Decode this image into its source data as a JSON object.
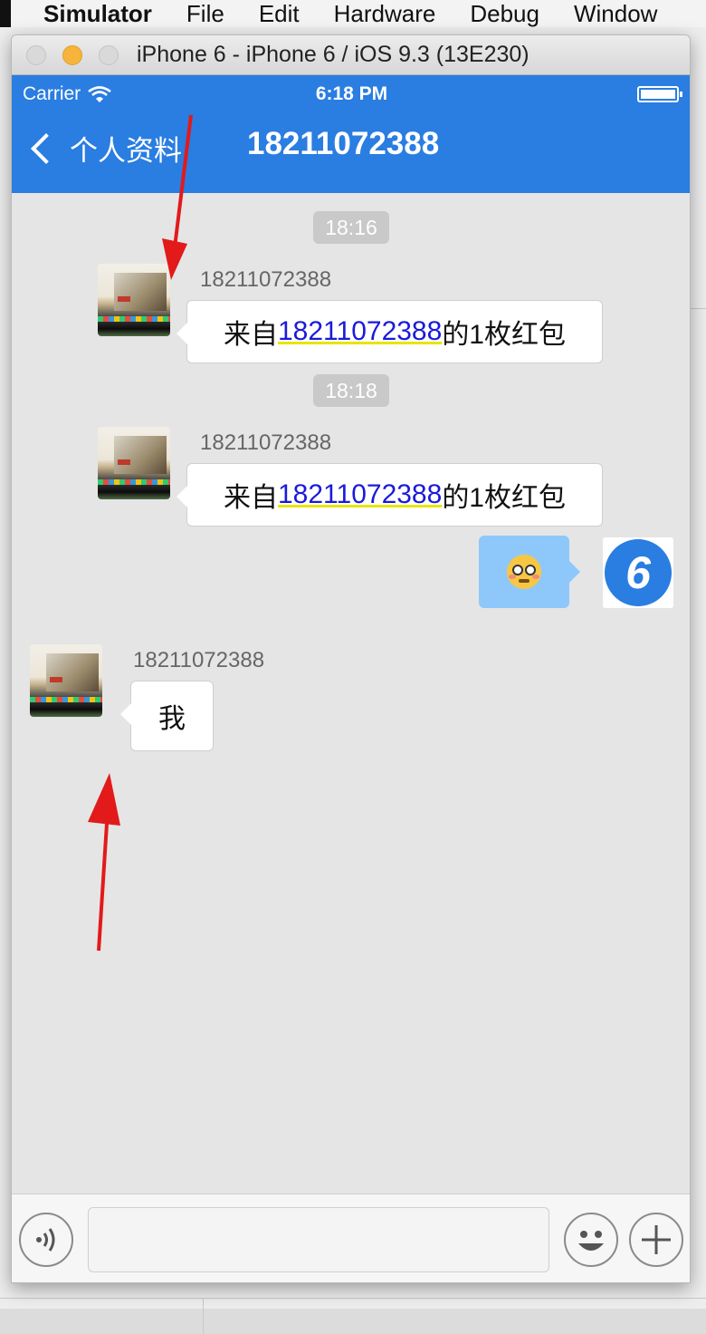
{
  "menubar": {
    "app_name": "Simulator",
    "menus": [
      "File",
      "Edit",
      "Hardware",
      "Debug",
      "Window"
    ]
  },
  "window": {
    "title": "iPhone 6 - iPhone 6 / iOS 9.3 (13E230)"
  },
  "status_bar": {
    "carrier": "Carrier",
    "time": "6:18 PM"
  },
  "nav": {
    "back_label": "个人资料",
    "title": "18211072388"
  },
  "messages": [
    {
      "type": "time",
      "text": "18:16"
    },
    {
      "type": "incoming",
      "sender": "18211072388",
      "prefix": "来自",
      "link": "18211072388",
      "suffix": "的1枚红包"
    },
    {
      "type": "time",
      "text": "18:18"
    },
    {
      "type": "incoming",
      "sender": "18211072388",
      "prefix": "来自",
      "link": "18211072388",
      "suffix": "的1枚红包"
    },
    {
      "type": "outgoing",
      "content": "flushed-face-emoji"
    },
    {
      "type": "incoming",
      "sender": "18211072388",
      "text": "我"
    }
  ],
  "input_bar": {
    "placeholder": "",
    "voice_icon": "voice-icon",
    "emoji_icon": "emoji-icon",
    "plus_icon": "plus-icon"
  },
  "colors": {
    "nav_blue": "#2a7de1",
    "outgoing_bubble": "#8ec8fb",
    "chat_bg": "#e5e5e5",
    "annotation_arrow": "#e21a1a"
  }
}
